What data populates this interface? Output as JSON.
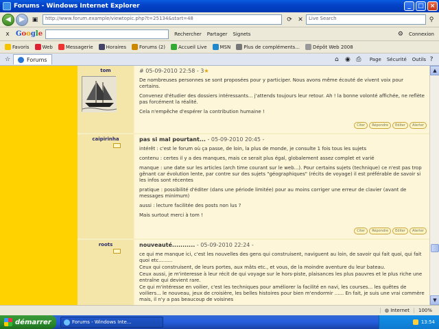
{
  "window": {
    "title": "Forums - Windows Internet Explorer"
  },
  "address": {
    "url": "http://www.forum.example/viewtopic.php?t=25134&start=48",
    "search_placeholder": "Live Search"
  },
  "google_toolbar": {
    "logo": "Google",
    "items": [
      "Rechercher",
      "Partager",
      "Signets",
      "Connexion"
    ]
  },
  "favorites": {
    "label": "Favoris",
    "items": [
      {
        "label": "Web",
        "color": "#d23"
      },
      {
        "label": "Messagerie",
        "color": "#e33"
      },
      {
        "label": "Horaires",
        "color": "#446"
      },
      {
        "label": "Forums (2)",
        "color": "#c80"
      },
      {
        "label": "Accueil Live",
        "color": "#3a3"
      },
      {
        "label": "MSN",
        "color": "#28c"
      },
      {
        "label": "Plus de compléments...",
        "color": "#777"
      },
      {
        "label": "Dépôt Web 2008",
        "color": "#999"
      }
    ]
  },
  "tabbar": {
    "tab_label": "Forums",
    "commands": [
      "Page",
      "Sécurité",
      "Outils"
    ]
  },
  "posts": [
    {
      "author": "tom",
      "title": "",
      "meta": "# 05-09-2010 22:58 - 3",
      "paragraphs": [
        "De nombreuses personnes se sont proposées pour y participer. Nous avons même écouté de vivent voix pour certains.",
        "Convenez d'étudier des dossiers intéressants... j'attends toujours leur retour. Ah ! la bonne volonté affichée, ne reflète pas forcément la réalité.",
        "Cela n'empêche d'espérer la contribution humaine !"
      ],
      "actions": [
        "Citer",
        "Répondre",
        "Editer",
        "Alerter"
      ]
    },
    {
      "author": "caipirinha",
      "title": "pas si mal pourtant...",
      "meta": " - 05-09-2010 20:45 -",
      "paragraphs": [
        "intérêt : c'est le forum où ça passe, de loin, la plus de monde, je consulte 1 fois tous les sujets",
        "contenu : certes il y a des manques, mais ce serait plus égal, globalement assez complet et varié",
        "manque : une date sur les articles (arch time courant sur le web...). Pour certains sujets (technique) ce n'est pas trop gênant car évolution lente, par contre sur des sujets \"géographiques\" (récits de voyage) il est préférable de savoir si les infos sont récentes",
        "pratique : possibilité d'éditer (dans une période limitée) pour au moins corriger une erreur de clavier (avant de messages minimum)",
        "aussi : lecture facilitée des posts non lus ?",
        "Mais surtout merci à tom !"
      ],
      "actions": [
        "Citer",
        "Répondre",
        "Editer",
        "Alerter"
      ]
    },
    {
      "author": "roots",
      "title": "nouveauté...........",
      "meta": " - 05-09-2010 22:24 -",
      "paragraphs": [
        "ce qui me manque ici, c'est les nouvelles des gens qui construisent, naviguent au loin, de savoir qui fait quoi, qui fait quoi etc.........",
        "Ceux qui construisent, de leurs portes, aux mâts etc., et vous, de la moindre aventure du leur bateau.",
        "Ceux aussi, je m'interesse à leur récit de qui voyage sur le hors-piste, plaisances les plus pauvres et le plus riche une entraîne qui devient rare.",
        "Ce qui m'intéresse en voilier, c'est les techniques pour améliorer la facilité en navi, les courses... les quêtes de voiliers... le nouveau, jeux de croisière, les belles histoires pour bien m'endormir ...... En fait, je suis une vrai commère mais, il n'y a pas beaucoup de voisines"
      ],
      "actions": []
    }
  ],
  "statusbar": {
    "zone": "Internet",
    "zoom": "100%"
  },
  "taskbar": {
    "start_label": "démarrer",
    "task_label": "Forums - Windows Inte...",
    "clock": "13:54"
  }
}
